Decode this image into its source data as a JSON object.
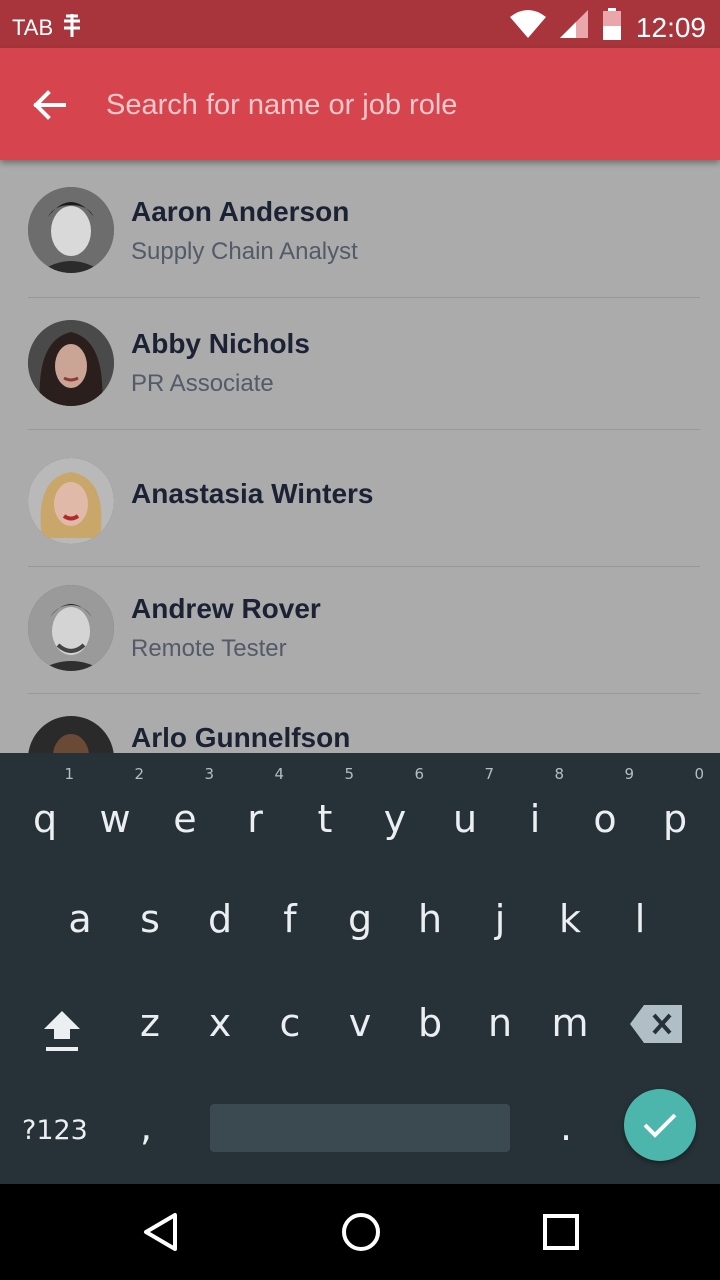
{
  "status_bar": {
    "carrier_label": "TAB",
    "time": "12:09",
    "icons": [
      "antenna-icon",
      "wifi-icon",
      "signal-icon",
      "battery-icon"
    ]
  },
  "search": {
    "placeholder": "Search for name or job role",
    "value": ""
  },
  "colors": {
    "status_bar": "#a8353c",
    "app_bar": "#d6454e",
    "list_bg": "#ababab",
    "keyboard_bg": "#263238",
    "enter_key": "#4db6ac"
  },
  "contacts": [
    {
      "name": "Aaron Anderson",
      "role": "Supply Chain Analyst"
    },
    {
      "name": "Abby Nichols",
      "role": "PR Associate"
    },
    {
      "name": "Anastasia Winters",
      "role": ""
    },
    {
      "name": "Andrew Rover",
      "role": "Remote Tester"
    },
    {
      "name": "Arlo Gunnelfson",
      "role": ""
    }
  ],
  "keyboard": {
    "row1": [
      {
        "key": "q",
        "hint": "1"
      },
      {
        "key": "w",
        "hint": "2"
      },
      {
        "key": "e",
        "hint": "3"
      },
      {
        "key": "r",
        "hint": "4"
      },
      {
        "key": "t",
        "hint": "5"
      },
      {
        "key": "y",
        "hint": "6"
      },
      {
        "key": "u",
        "hint": "7"
      },
      {
        "key": "i",
        "hint": "8"
      },
      {
        "key": "o",
        "hint": "9"
      },
      {
        "key": "p",
        "hint": "0"
      }
    ],
    "row2": [
      "a",
      "s",
      "d",
      "f",
      "g",
      "h",
      "j",
      "k",
      "l"
    ],
    "row3": [
      "z",
      "x",
      "c",
      "v",
      "b",
      "n",
      "m"
    ],
    "symbols_label": "?123",
    "comma": ",",
    "period": "."
  }
}
